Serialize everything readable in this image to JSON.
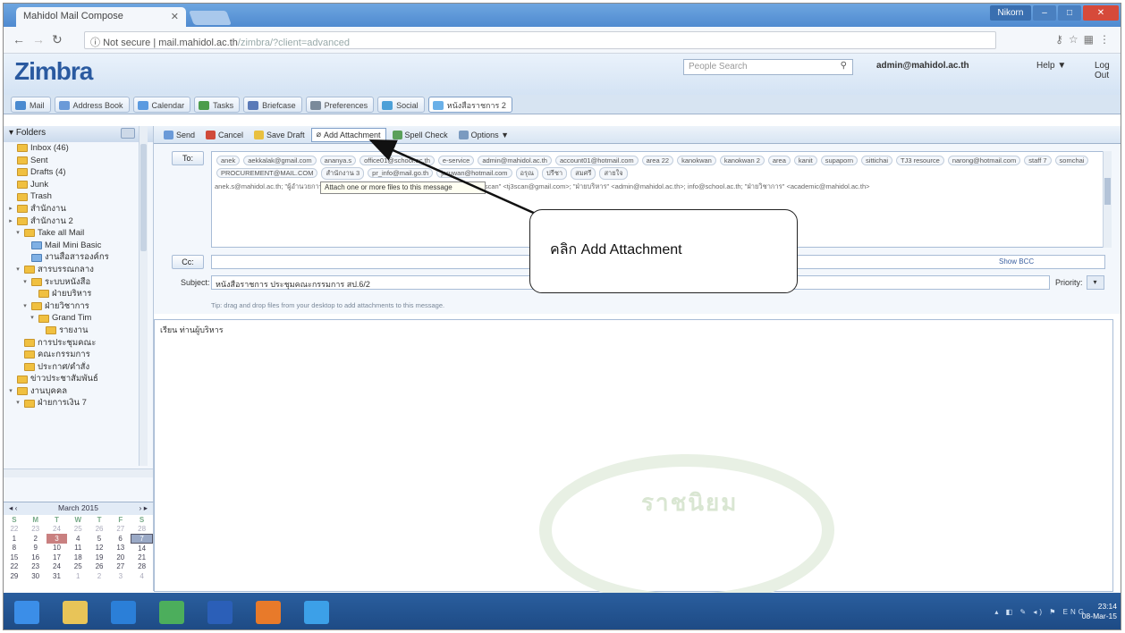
{
  "browser": {
    "tab_title": "Mahidol Mail Compose",
    "url_host": "mail.mahidol.ac.th",
    "url_security": "Not secure",
    "url_path": "/zimbra/?client=advanced"
  },
  "window_controls": {
    "user_badge": "Nikorn",
    "minimize": "–",
    "maximize": "□",
    "close": "✕"
  },
  "zimbra": {
    "logo": "Zimbra",
    "people_search_placeholder": "People Search",
    "username": "admin@mahidol.ac.th",
    "help": "Help ▼",
    "logout": "Log Out"
  },
  "app_tabs": [
    {
      "label": "Mail",
      "color": "#4a8ad0"
    },
    {
      "label": "Address Book",
      "color": "#6a9ad8"
    },
    {
      "label": "Calendar",
      "color": "#5a9ae0"
    },
    {
      "label": "Tasks",
      "color": "#4c9c4c"
    },
    {
      "label": "Briefcase",
      "color": "#5a7ab8"
    },
    {
      "label": "Preferences",
      "color": "#7a8a9a"
    },
    {
      "label": "Social",
      "color": "#4ca0d8"
    },
    {
      "label": "หนังสือราชการ 2",
      "color": "#6ab0e8"
    }
  ],
  "folders": {
    "header": "Folders",
    "items": [
      {
        "label": "Inbox (46)",
        "indent": 0,
        "tw": "",
        "blue": false
      },
      {
        "label": "Sent",
        "indent": 0,
        "tw": "",
        "blue": false
      },
      {
        "label": "Drafts (4)",
        "indent": 0,
        "tw": "",
        "blue": false
      },
      {
        "label": "Junk",
        "indent": 0,
        "tw": "",
        "blue": false
      },
      {
        "label": "Trash",
        "indent": 0,
        "tw": "",
        "blue": false
      },
      {
        "label": "สำนักงาน",
        "indent": 0,
        "tw": "▸",
        "blue": false
      },
      {
        "label": "สำนักงาน 2",
        "indent": 0,
        "tw": "▸",
        "blue": false
      },
      {
        "label": "Take all Mail",
        "indent": 1,
        "tw": "▾",
        "blue": false
      },
      {
        "label": "Mail Mini Basic",
        "indent": 2,
        "tw": "",
        "blue": true
      },
      {
        "label": "งานสื่อสารองค์กร",
        "indent": 2,
        "tw": "",
        "blue": true
      },
      {
        "label": "สารบรรณกลาง",
        "indent": 1,
        "tw": "▾",
        "blue": false
      },
      {
        "label": "ระบบหนังสือ",
        "indent": 2,
        "tw": "▾",
        "blue": false
      },
      {
        "label": "ฝ่ายบริหาร",
        "indent": 3,
        "tw": "",
        "blue": false
      },
      {
        "label": "ฝ่ายวิชาการ",
        "indent": 2,
        "tw": "▾",
        "blue": false
      },
      {
        "label": "Grand Tim",
        "indent": 3,
        "tw": "▾",
        "blue": false
      },
      {
        "label": "รายงาน",
        "indent": 4,
        "tw": "",
        "blue": false
      },
      {
        "label": "การประชุมคณะ",
        "indent": 1,
        "tw": "",
        "blue": false
      },
      {
        "label": "คณะกรรมการ",
        "indent": 1,
        "tw": "",
        "blue": false
      },
      {
        "label": "ประกาศ/คำสั่ง",
        "indent": 1,
        "tw": "",
        "blue": false
      },
      {
        "label": "ข่าวประชาสัมพันธ์",
        "indent": 0,
        "tw": "",
        "blue": false
      },
      {
        "label": "งานบุคคล",
        "indent": 0,
        "tw": "▾",
        "blue": false
      },
      {
        "label": "ฝ่ายการเงิน 7",
        "indent": 1,
        "tw": "▾",
        "blue": false
      }
    ]
  },
  "calendar": {
    "title": "March 2015",
    "prev": "◂ ‹",
    "next": "› ▸",
    "dow": [
      "S",
      "M",
      "T",
      "W",
      "T",
      "F",
      "S"
    ],
    "weeks": [
      [
        "22",
        "23",
        "24",
        "25",
        "26",
        "27",
        "28"
      ],
      [
        "1",
        "2",
        "3",
        "4",
        "5",
        "6",
        "7"
      ],
      [
        "8",
        "9",
        "10",
        "11",
        "12",
        "13",
        "14"
      ],
      [
        "15",
        "16",
        "17",
        "18",
        "19",
        "20",
        "21"
      ],
      [
        "22",
        "23",
        "24",
        "25",
        "26",
        "27",
        "28"
      ],
      [
        "29",
        "30",
        "31",
        "1",
        "2",
        "3",
        "4"
      ]
    ]
  },
  "toolbar": {
    "send": "Send",
    "cancel": "Cancel",
    "save_draft": "Save Draft",
    "add_attachment": "Add Attachment",
    "spell_check": "Spell Check",
    "options": "Options ▼"
  },
  "compose": {
    "to_label": "To:",
    "cc_label": "Cc:",
    "show_bcc": "Show BCC",
    "subject_label": "Subject:",
    "subject_value": "หนังสือราชการ ประชุมคณะกรรมการ สป.6/2",
    "priority_label": "Priority:",
    "priority_value": "▾",
    "hint": "Tip: drag and drop files from your desktop to add attachments to this message.",
    "tooltip": "Attach one or more files to this message",
    "recipients": [
      "anek",
      "aekkalak@gmail.com",
      "ananya.s",
      "office01@school.ac.th",
      "e-service",
      "admin@mahidol.ac.th",
      "account01@hotmail.com",
      "area 22",
      "kanokwan",
      "kanokwan 2",
      "area",
      "kanit",
      "supaporn",
      "sittichai",
      "TJ3 resource",
      "narong@hotmail.com",
      "staff 7",
      "somchai",
      "PROCUREMENT@MAIL.COM",
      "สำนักงาน 3",
      "pr_info@mail.go.th",
      "jaruwan@hotmail.com",
      "อรุณ",
      "ปรีชา",
      "สมศรี",
      "สายใจ"
    ],
    "raw_recipients": "anek.s@mahidol.ac.th; \"ผู้อำนวยการ\" <director@mahidol.ac.th>; ubon@hotmail.com; \"TJ3 scan\" <tj3scan@gmail.com>; \"ฝ่ายบริหาร\" <admin@mahidol.ac.th>; info@school.ac.th; \"ฝ่ายวิชาการ\" <academic@mahidol.ac.th>"
  },
  "body_text": "เรียน ท่านผู้บริหาร",
  "watermark_text": "ราชนิยม",
  "callout": {
    "text": "คลิก Add Attachment"
  },
  "taskbar": {
    "clock_time": "23:14",
    "clock_date": "08-Mar-15",
    "tray": "▴ ◧ ✎ ◂) ⚑ ENG",
    "icons": [
      {
        "name": "windows-start-icon",
        "color": "#3b8ee8"
      },
      {
        "name": "file-explorer-icon",
        "color": "#e8c458"
      },
      {
        "name": "internet-explorer-icon",
        "color": "#2b7fd8"
      },
      {
        "name": "photos-app-icon",
        "color": "#4cae5c"
      },
      {
        "name": "word-icon",
        "color": "#2b5fb8"
      },
      {
        "name": "firefox-icon",
        "color": "#e87a2a"
      },
      {
        "name": "chrome-icon",
        "color": "#3ca0e8"
      }
    ]
  }
}
